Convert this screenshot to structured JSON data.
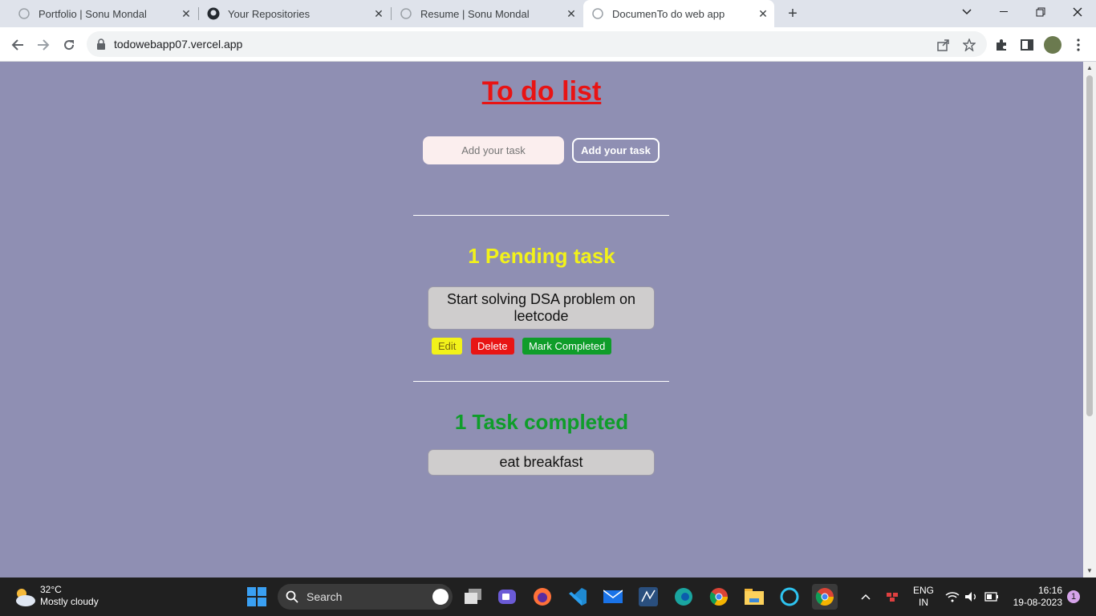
{
  "browser": {
    "tabs": [
      {
        "title": "Portfolio | Sonu Mondal",
        "active": false
      },
      {
        "title": "Your Repositories",
        "active": false
      },
      {
        "title": "Resume | Sonu Mondal",
        "active": false
      },
      {
        "title": "DocumenTo do web app",
        "active": true
      }
    ],
    "url": "todowebapp07.vercel.app"
  },
  "app": {
    "title": "To do list",
    "input_placeholder": "Add your task",
    "add_button_label": "Add your task",
    "pending": {
      "heading": "1 Pending task",
      "tasks": [
        "Start solving DSA problem on leetcode"
      ]
    },
    "actions": {
      "edit": "Edit",
      "delete": "Delete",
      "complete": "Mark Completed"
    },
    "completed": {
      "heading": "1 Task completed",
      "tasks": [
        "eat breakfast"
      ]
    },
    "colors": {
      "background": "#8f8fb3",
      "title": "#e81414",
      "pending": "#f2f21a",
      "completed": "#0f9d2a"
    }
  },
  "taskbar": {
    "weather_temp": "32°C",
    "weather_desc": "Mostly cloudy",
    "search_label": "Search",
    "lang_top": "ENG",
    "lang_bottom": "IN",
    "time": "16:16",
    "date": "19-08-2023",
    "notification_count": "1"
  }
}
